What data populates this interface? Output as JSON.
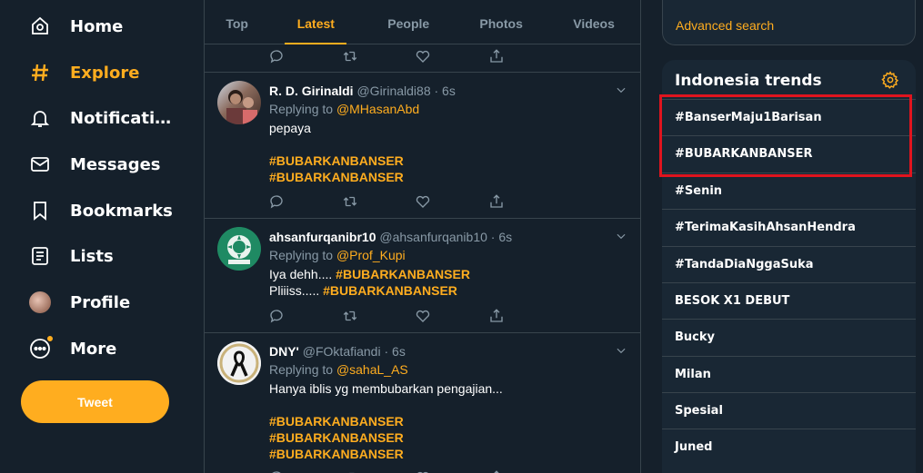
{
  "nav": {
    "items": [
      {
        "label": "Home",
        "icon": "home-icon"
      },
      {
        "label": "Explore",
        "icon": "hashtag-icon"
      },
      {
        "label": "Notificati…",
        "icon": "bell-icon"
      },
      {
        "label": "Messages",
        "icon": "envelope-icon"
      },
      {
        "label": "Bookmarks",
        "icon": "bookmark-icon"
      },
      {
        "label": "Lists",
        "icon": "list-icon"
      },
      {
        "label": "Profile",
        "icon": "avatar"
      },
      {
        "label": "More",
        "icon": "more-icon"
      }
    ],
    "tweet_button": "Tweet"
  },
  "tabs": [
    "Top",
    "Latest",
    "People",
    "Photos",
    "Videos"
  ],
  "tweets": [
    {
      "name": "R. D. Girinaldi",
      "handle": "@Girinaldi88",
      "time": "· 6s",
      "reply_prefix": "Replying to",
      "reply_to": "@MHasanAbd",
      "lines": [
        "pepaya"
      ],
      "tags": [
        "#BUBARKANBANSER",
        "#BUBARKANBANSER"
      ]
    },
    {
      "name": "ahsanfurqanibr10",
      "handle": "@ahsanfurqanib10",
      "time": "· 6s",
      "reply_prefix": "Replying to",
      "reply_to": "@Prof_Kupi",
      "line1_text": "Iya dehh.... ",
      "line1_tag": "#BUBARKANBANSER",
      "line2_text": "Pliiiss..... ",
      "line2_tag": "#BUBARKANBANSER"
    },
    {
      "name": "DNY'",
      "handle": "@FOktafiandi",
      "time": "· 6s",
      "reply_prefix": "Replying to",
      "reply_to": "@sahaL_AS",
      "lines": [
        "Hanya iblis yg membubarkan pengajian..."
      ],
      "tags": [
        "#BUBARKANBANSER",
        "#BUBARKANBANSER",
        "#BUBARKANBANSER"
      ]
    }
  ],
  "sidebar": {
    "advanced_search": "Advanced search",
    "trends_title": "Indonesia trends",
    "trends": [
      "#BanserMaju1Barisan",
      "#BUBARKANBANSER",
      "#Senin",
      "#TerimaKasihAhsanHendra",
      "#TandaDiaNggaSuka",
      "BESOK X1 DEBUT",
      "Bucky",
      "Milan",
      "Spesial",
      "Juned"
    ]
  },
  "colors": {
    "background": "#15202b",
    "panel": "#192734",
    "accent": "#ffad1f",
    "border": "#38444d",
    "muted": "#8899a6",
    "highlight_box": "#e0141e"
  }
}
